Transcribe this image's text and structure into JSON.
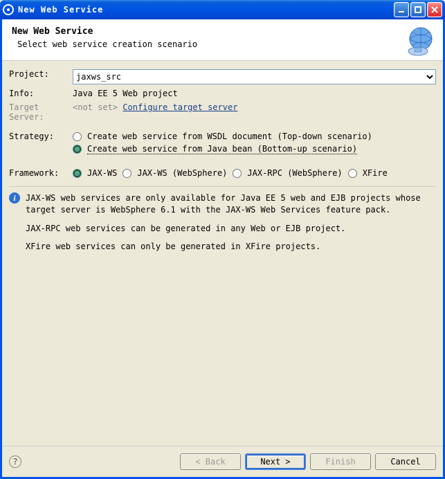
{
  "window": {
    "title": "New Web Service"
  },
  "header": {
    "title": "New Web Service",
    "subtitle": "Select web service creation scenario"
  },
  "form": {
    "project_label": "Project:",
    "project_value": "jaxws_src",
    "info_label": "Info:",
    "info_value": "Java EE 5 Web project",
    "target_server_label": "Target Server:",
    "target_server_value": "<not set>",
    "configure_link": "Configure target server",
    "strategy_label": "Strategy:",
    "strategy_options": {
      "topdown": "Create web service from WSDL document (Top-down scenario)",
      "bottomup": "Create web service from Java bean (Bottom-up scenario)"
    },
    "framework_label": "Framework:",
    "framework_options": {
      "jaxws": "JAX-WS",
      "jaxws_ws": "JAX-WS (WebSphere)",
      "jaxrpc_ws": "JAX-RPC (WebSphere)",
      "xfire": "XFire"
    }
  },
  "info": {
    "p1": "JAX-WS web services are only available for Java EE 5 web and EJB projects whose target server is WebSphere 6.1 with the JAX-WS Web Services feature pack.",
    "p2": "JAX-RPC web services can be generated in any Web or EJB project.",
    "p3": "XFire web services can only be generated in XFire projects."
  },
  "footer": {
    "back": "< Back",
    "next": "Next >",
    "finish": "Finish",
    "cancel": "Cancel"
  }
}
